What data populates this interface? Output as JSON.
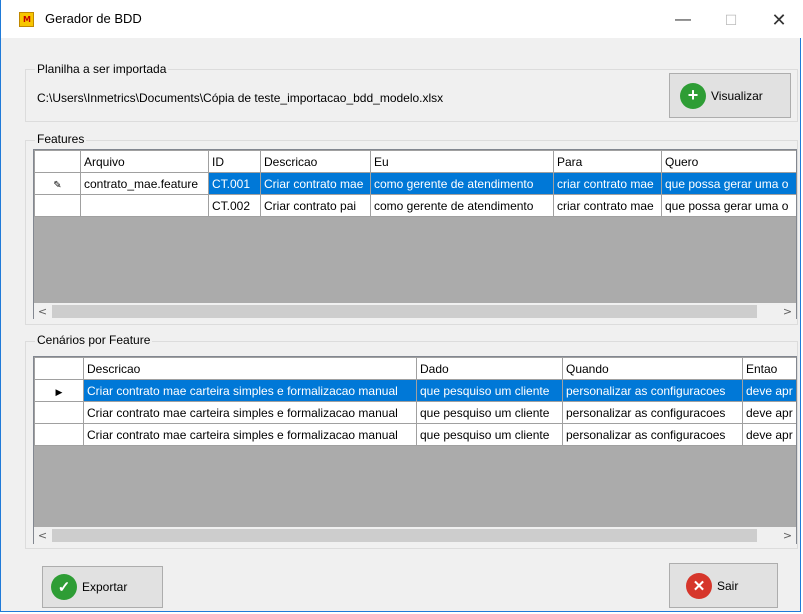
{
  "window": {
    "title": "Gerador de BDD",
    "icon_text": "M"
  },
  "import_group": {
    "label": "Planilha a ser importada",
    "path": "C:\\Users\\Inmetrics\\Documents\\Cópia de teste_importacao_bdd_modelo.xlsx",
    "view_button": "Visualizar"
  },
  "features": {
    "label": "Features",
    "columns": [
      "Arquivo",
      "ID",
      "Descricao",
      "Eu",
      "Para",
      "Quero"
    ],
    "rows": [
      [
        "contrato_mae.feature",
        "CT.001",
        "Criar contrato mae",
        "como gerente de atendimento",
        "criar contrato mae",
        "que possa gerar uma o"
      ],
      [
        "",
        "CT.002",
        "Criar contrato pai",
        "como gerente de atendimento",
        "criar contrato mae",
        "que possa gerar uma o"
      ]
    ]
  },
  "scenarios": {
    "label": "Cenários por Feature",
    "columns": [
      "Descricao",
      "Dado",
      "Quando",
      "Entao"
    ],
    "rows": [
      [
        "Criar contrato mae carteira simples e formalizacao manual",
        "que pesquiso um cliente",
        "personalizar as configuracoes",
        "deve apr"
      ],
      [
        "Criar contrato mae carteira simples e formalizacao manual",
        "que pesquiso um cliente",
        "personalizar as configuracoes",
        "deve apr"
      ],
      [
        "Criar contrato mae carteira simples e formalizacao manual",
        "que pesquiso um cliente",
        "personalizar as configuracoes",
        "deve apr"
      ]
    ]
  },
  "footer": {
    "export_button": "Exportar",
    "exit_button": "Sair"
  },
  "colors": {
    "selection": "#0078d7",
    "grid_background": "#ababab",
    "add_icon": "#2e9d35",
    "export_icon": "#2e9d35",
    "exit_icon": "#d6362b"
  }
}
